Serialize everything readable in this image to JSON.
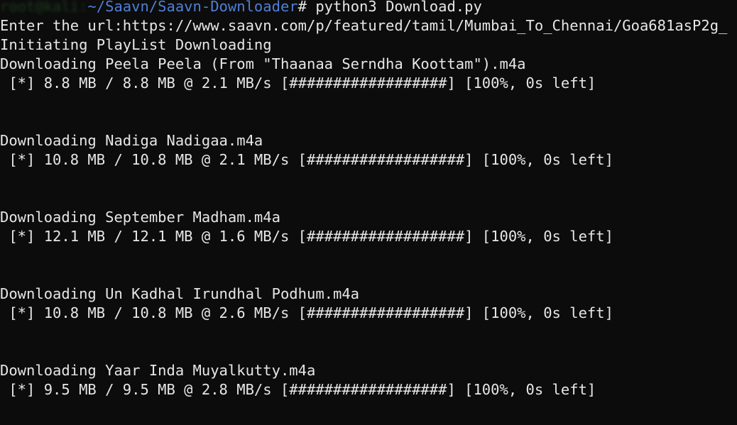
{
  "prompt": {
    "host_blurred": "root@kali:",
    "path": "~/Saavn/Saavn-Downloader",
    "symbol": "#",
    "command": " python3 Download.py"
  },
  "url_line": "Enter the url:https://www.saavn.com/p/featured/tamil/Mumbai_To_Chennai/Goa681asP2g_",
  "status_line": "Initiating PlayList Downloading",
  "downloads": [
    {
      "title": "Downloading Peela Peela (From \"Thaanaa Serndha Koottam\").m4a",
      "progress": " [*] 8.8 MB / 8.8 MB @ 2.1 MB/s [##################] [100%, 0s left]",
      "percent": 100
    },
    {
      "title": "Downloading Nadiga Nadigaa.m4a",
      "progress": " [*] 10.8 MB / 10.8 MB @ 2.1 MB/s [##################] [100%, 0s left]",
      "percent": 100
    },
    {
      "title": "Downloading September Madham.m4a",
      "progress": " [*] 12.1 MB / 12.1 MB @ 1.6 MB/s [##################] [100%, 0s left]",
      "percent": 100
    },
    {
      "title": "Downloading Un Kadhal Irundhal Podhum.m4a",
      "progress": " [*] 10.8 MB / 10.8 MB @ 2.6 MB/s [##################] [100%, 0s left]",
      "percent": 100
    },
    {
      "title": "Downloading Yaar Inda Muyalkutty.m4a",
      "progress": " [*] 9.5 MB / 9.5 MB @ 2.8 MB/s [##################] [100%, 0s left]",
      "percent": 100
    }
  ],
  "colors": {
    "background": "#0c0c0c",
    "text": "#e6e6e6",
    "path": "#4f7fd6"
  }
}
